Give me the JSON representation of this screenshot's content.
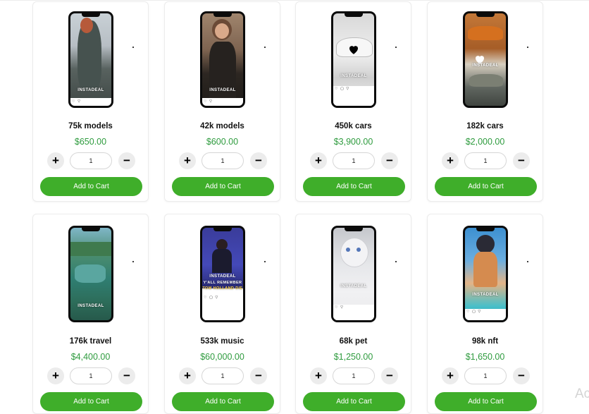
{
  "shared": {
    "watermark_text": "INSTADEAL",
    "add_to_cart_label": "Add to Cart",
    "plus_symbol": "+",
    "minus_symbol": "−"
  },
  "products": [
    {
      "title": "75k models",
      "price": "$650.00",
      "quantity": "1",
      "niche": "models"
    },
    {
      "title": "42k models",
      "price": "$600.00",
      "quantity": "1",
      "niche": "models"
    },
    {
      "title": "450k cars",
      "price": "$3,900.00",
      "quantity": "1",
      "niche": "cars"
    },
    {
      "title": "182k cars",
      "price": "$2,000.00",
      "quantity": "1",
      "niche": "cars"
    },
    {
      "title": "176k travel",
      "price": "$4,400.00",
      "quantity": "1",
      "niche": "travel"
    },
    {
      "title": "533k music",
      "price": "$60,000.00",
      "quantity": "1",
      "niche": "music"
    },
    {
      "title": "68k pet",
      "price": "$1,250.00",
      "quantity": "1",
      "niche": "pet"
    },
    {
      "title": "98k nft",
      "price": "$1,650.00",
      "quantity": "1",
      "niche": "nft"
    }
  ],
  "music_screen_text": {
    "line1": "Y'ALL REMEMBER",
    "line2": "TOM HOLLAND DIE"
  },
  "partial_overlay_text": "Ac",
  "colors": {
    "price_green": "#2e9b3e",
    "button_green": "#3fae2a",
    "qty_button_bg": "#ececec"
  }
}
